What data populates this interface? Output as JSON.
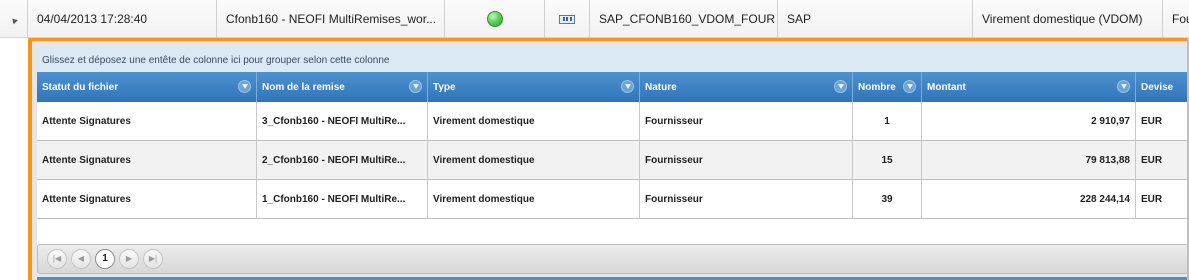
{
  "master_row": {
    "date": "04/04/2013 17:28:40",
    "remise": "Cfonb160 - NEOFI MultiRemises_wor...",
    "status_color": "#4ccc47",
    "code": "SAP_CFONB160_VDOM_FOUR",
    "system": "SAP",
    "type": "Virement domestique (VDOM)",
    "truncated": "Fou"
  },
  "group_panel_text": "Glissez et déposez une entête de colonne ici pour grouper selon cette colonne",
  "columns": [
    "Statut du fichier",
    "Nom de la remise",
    "Type",
    "Nature",
    "Nombre",
    "Montant",
    "Devise"
  ],
  "rows": [
    {
      "statut": "Attente Signatures",
      "nom": "3_Cfonb160 - NEOFI MultiRe...",
      "type": "Virement domestique",
      "nature": "Fournisseur",
      "nombre": "1",
      "montant": "2 910,97",
      "devise": "EUR"
    },
    {
      "statut": "Attente Signatures",
      "nom": "2_Cfonb160 - NEOFI MultiRe...",
      "type": "Virement domestique",
      "nature": "Fournisseur",
      "nombre": "15",
      "montant": "79 813,88",
      "devise": "EUR"
    },
    {
      "statut": "Attente Signatures",
      "nom": "1_Cfonb160 - NEOFI MultiRe...",
      "type": "Virement domestique",
      "nature": "Fournisseur",
      "nombre": "39",
      "montant": "228 244,14",
      "devise": "EUR"
    }
  ],
  "pager": {
    "first_icon": "first-page-icon",
    "prev_icon": "prev-page-icon",
    "current_page": "1",
    "next_icon": "next-page-icon",
    "last_icon": "last-page-icon"
  },
  "colors": {
    "accent_orange": "#f7941d",
    "header_blue": "#2f75b8",
    "group_panel": "#dbe9f7"
  }
}
